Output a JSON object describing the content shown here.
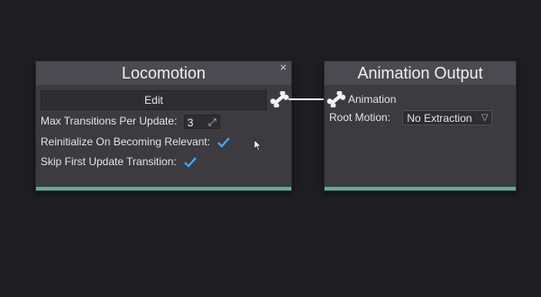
{
  "locomotion_node": {
    "title": "Locomotion",
    "close_label": "×",
    "edit_label": "Edit",
    "max_transitions_label": "Max Transitions Per Update:",
    "max_transitions_value": "3",
    "reinitialize_label": "Reinitialize On Becoming Relevant:",
    "reinitialize_checked": true,
    "skip_first_label": "Skip First Update Transition:",
    "skip_first_checked": true
  },
  "output_node": {
    "title": "Animation Output",
    "animation_port_label": "Animation",
    "root_motion_label": "Root Motion:",
    "root_motion_value": "No Extraction"
  },
  "colors": {
    "accent_footer": "#5fae96",
    "checkmark": "#3fa9f5",
    "wire": "#f4f4f4"
  }
}
